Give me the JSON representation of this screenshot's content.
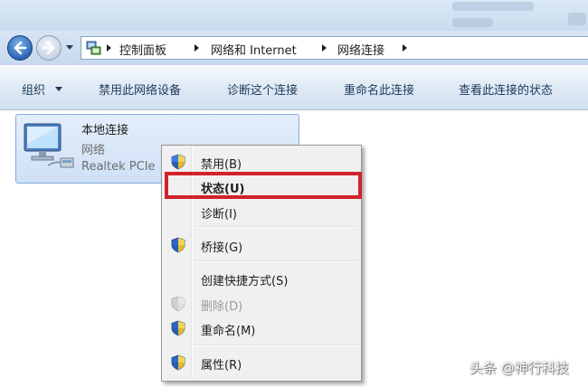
{
  "address_bar": {
    "breadcrumbs": [
      "控制面板",
      "网络和 Internet",
      "网络连接"
    ]
  },
  "toolbar": {
    "organize_label": "组织",
    "disable_label": "禁用此网络设备",
    "diagnose_label": "诊断这个连接",
    "rename_label": "重命名此连接",
    "view_status_label": "查看此连接的状态"
  },
  "connection": {
    "name": "本地连接",
    "network": "网络",
    "device": "Realtek PCIe"
  },
  "context_menu": {
    "items": [
      {
        "label": "禁用(B)",
        "icon": "uac-shield-icon"
      },
      {
        "label": "状态(U)",
        "icon": ""
      },
      {
        "label": "诊断(I)",
        "icon": ""
      },
      {
        "label": "桥接(G)",
        "icon": "uac-shield-icon"
      },
      {
        "label": "创建快捷方式(S)",
        "icon": ""
      },
      {
        "label": "删除(D)",
        "icon": "uac-shield-icon",
        "disabled": true
      },
      {
        "label": "重命名(M)",
        "icon": "uac-shield-icon"
      },
      {
        "label": "属性(R)",
        "icon": "uac-shield-icon"
      }
    ],
    "default_item": "状态(U)"
  },
  "annotation": {
    "highlight_color": "#d2222a"
  },
  "watermark": "头条 @神行科技"
}
